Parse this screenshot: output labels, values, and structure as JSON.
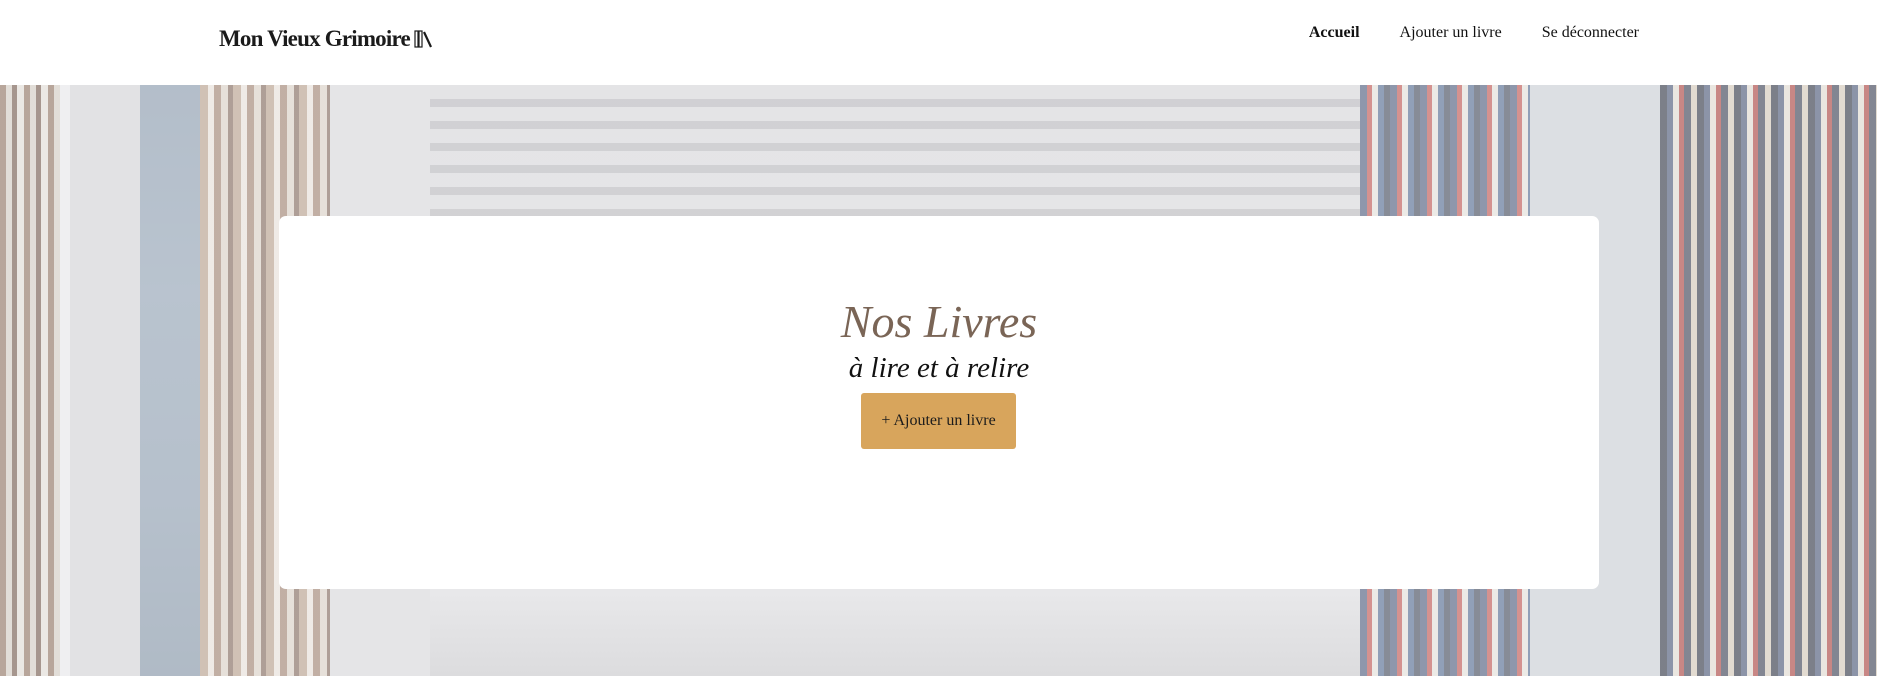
{
  "header": {
    "logo_text": "Mon Vieux Grimoire",
    "logo_icon": "books-icon",
    "nav": [
      {
        "label": "Accueil",
        "active": true
      },
      {
        "label": "Ajouter un livre",
        "active": false
      },
      {
        "label": "Se déconnecter",
        "active": false
      }
    ]
  },
  "hero": {
    "title": "Nos Livres",
    "subtitle": "à lire et à relire",
    "add_button_label": "+ Ajouter un livre"
  },
  "colors": {
    "title": "#7a6556",
    "button": "#d8a55c",
    "background": "#ffffff"
  }
}
